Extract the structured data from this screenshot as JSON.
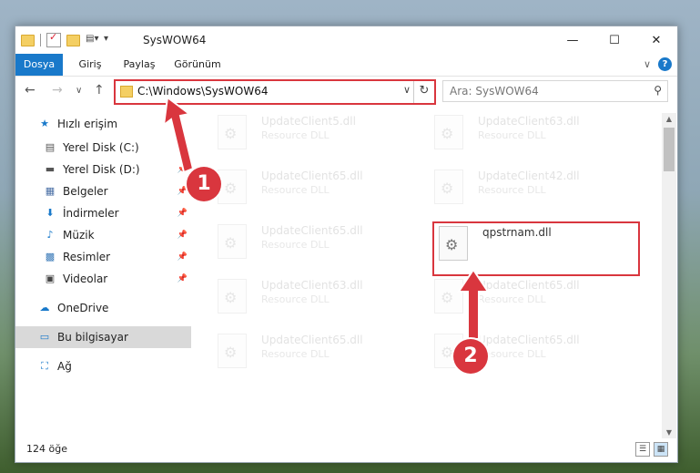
{
  "window": {
    "title": "SysWOW64",
    "controls": {
      "minimize": "—",
      "maximize": "☐",
      "close": "✕"
    }
  },
  "ribbon": {
    "tabs": [
      "Dosya",
      "Giriş",
      "Paylaş",
      "Görünüm"
    ],
    "expand": "∨",
    "help": "?"
  },
  "nav_buttons": {
    "back": "←",
    "forward": "→",
    "recent": "∨",
    "up": "↑"
  },
  "address": {
    "path": "C:\\Windows\\SysWOW64",
    "dropdown": "∨",
    "refresh": "↻"
  },
  "search": {
    "placeholder": "Ara: SysWOW64",
    "icon": "⚲"
  },
  "nav_pane": {
    "items": [
      {
        "label": "Hızlı erişim",
        "icon": "★"
      },
      {
        "label": "Yerel Disk (C:)",
        "icon": "▤"
      },
      {
        "label": "Yerel Disk (D:)",
        "icon": "▬"
      },
      {
        "label": "Belgeler",
        "icon": "▦"
      },
      {
        "label": "İndirmeler",
        "icon": "⬇"
      },
      {
        "label": "Müzik",
        "icon": "♪"
      },
      {
        "label": "Resimler",
        "icon": "▩"
      },
      {
        "label": "Videolar",
        "icon": "▣"
      },
      {
        "label": "OneDrive",
        "icon": "☁"
      },
      {
        "label": "Bu bilgisayar",
        "icon": "▭"
      },
      {
        "label": "Ağ",
        "icon": "⛶"
      }
    ],
    "pin": "📌"
  },
  "files": [
    {
      "name": "UpdateClient5.dll",
      "type": "Resource DLL"
    },
    {
      "name": "UpdateClient63.dll",
      "type": "Resource DLL"
    },
    {
      "name": "UpdateClient65.dll",
      "type": "Resource DLL"
    },
    {
      "name": "UpdateClient42.dll",
      "type": "Resource DLL"
    },
    {
      "name": "UpdateClient65.dll",
      "type": "Resource DLL"
    },
    {
      "name": "qpstrnam.dll",
      "type": ""
    },
    {
      "name": "UpdateClient63.dll",
      "type": "Resource DLL"
    },
    {
      "name": "UpdateClient65.dll",
      "type": "Resource DLL"
    },
    {
      "name": "UpdateClient65.dll",
      "type": "Resource DLL"
    },
    {
      "name": "UpdateClient65.dll",
      "type": "Resource DLL"
    }
  ],
  "status": {
    "count": "124 öğe"
  },
  "callouts": {
    "one": "1",
    "two": "2"
  },
  "colors": {
    "accent": "#1979ca",
    "highlight": "#d9363e"
  }
}
